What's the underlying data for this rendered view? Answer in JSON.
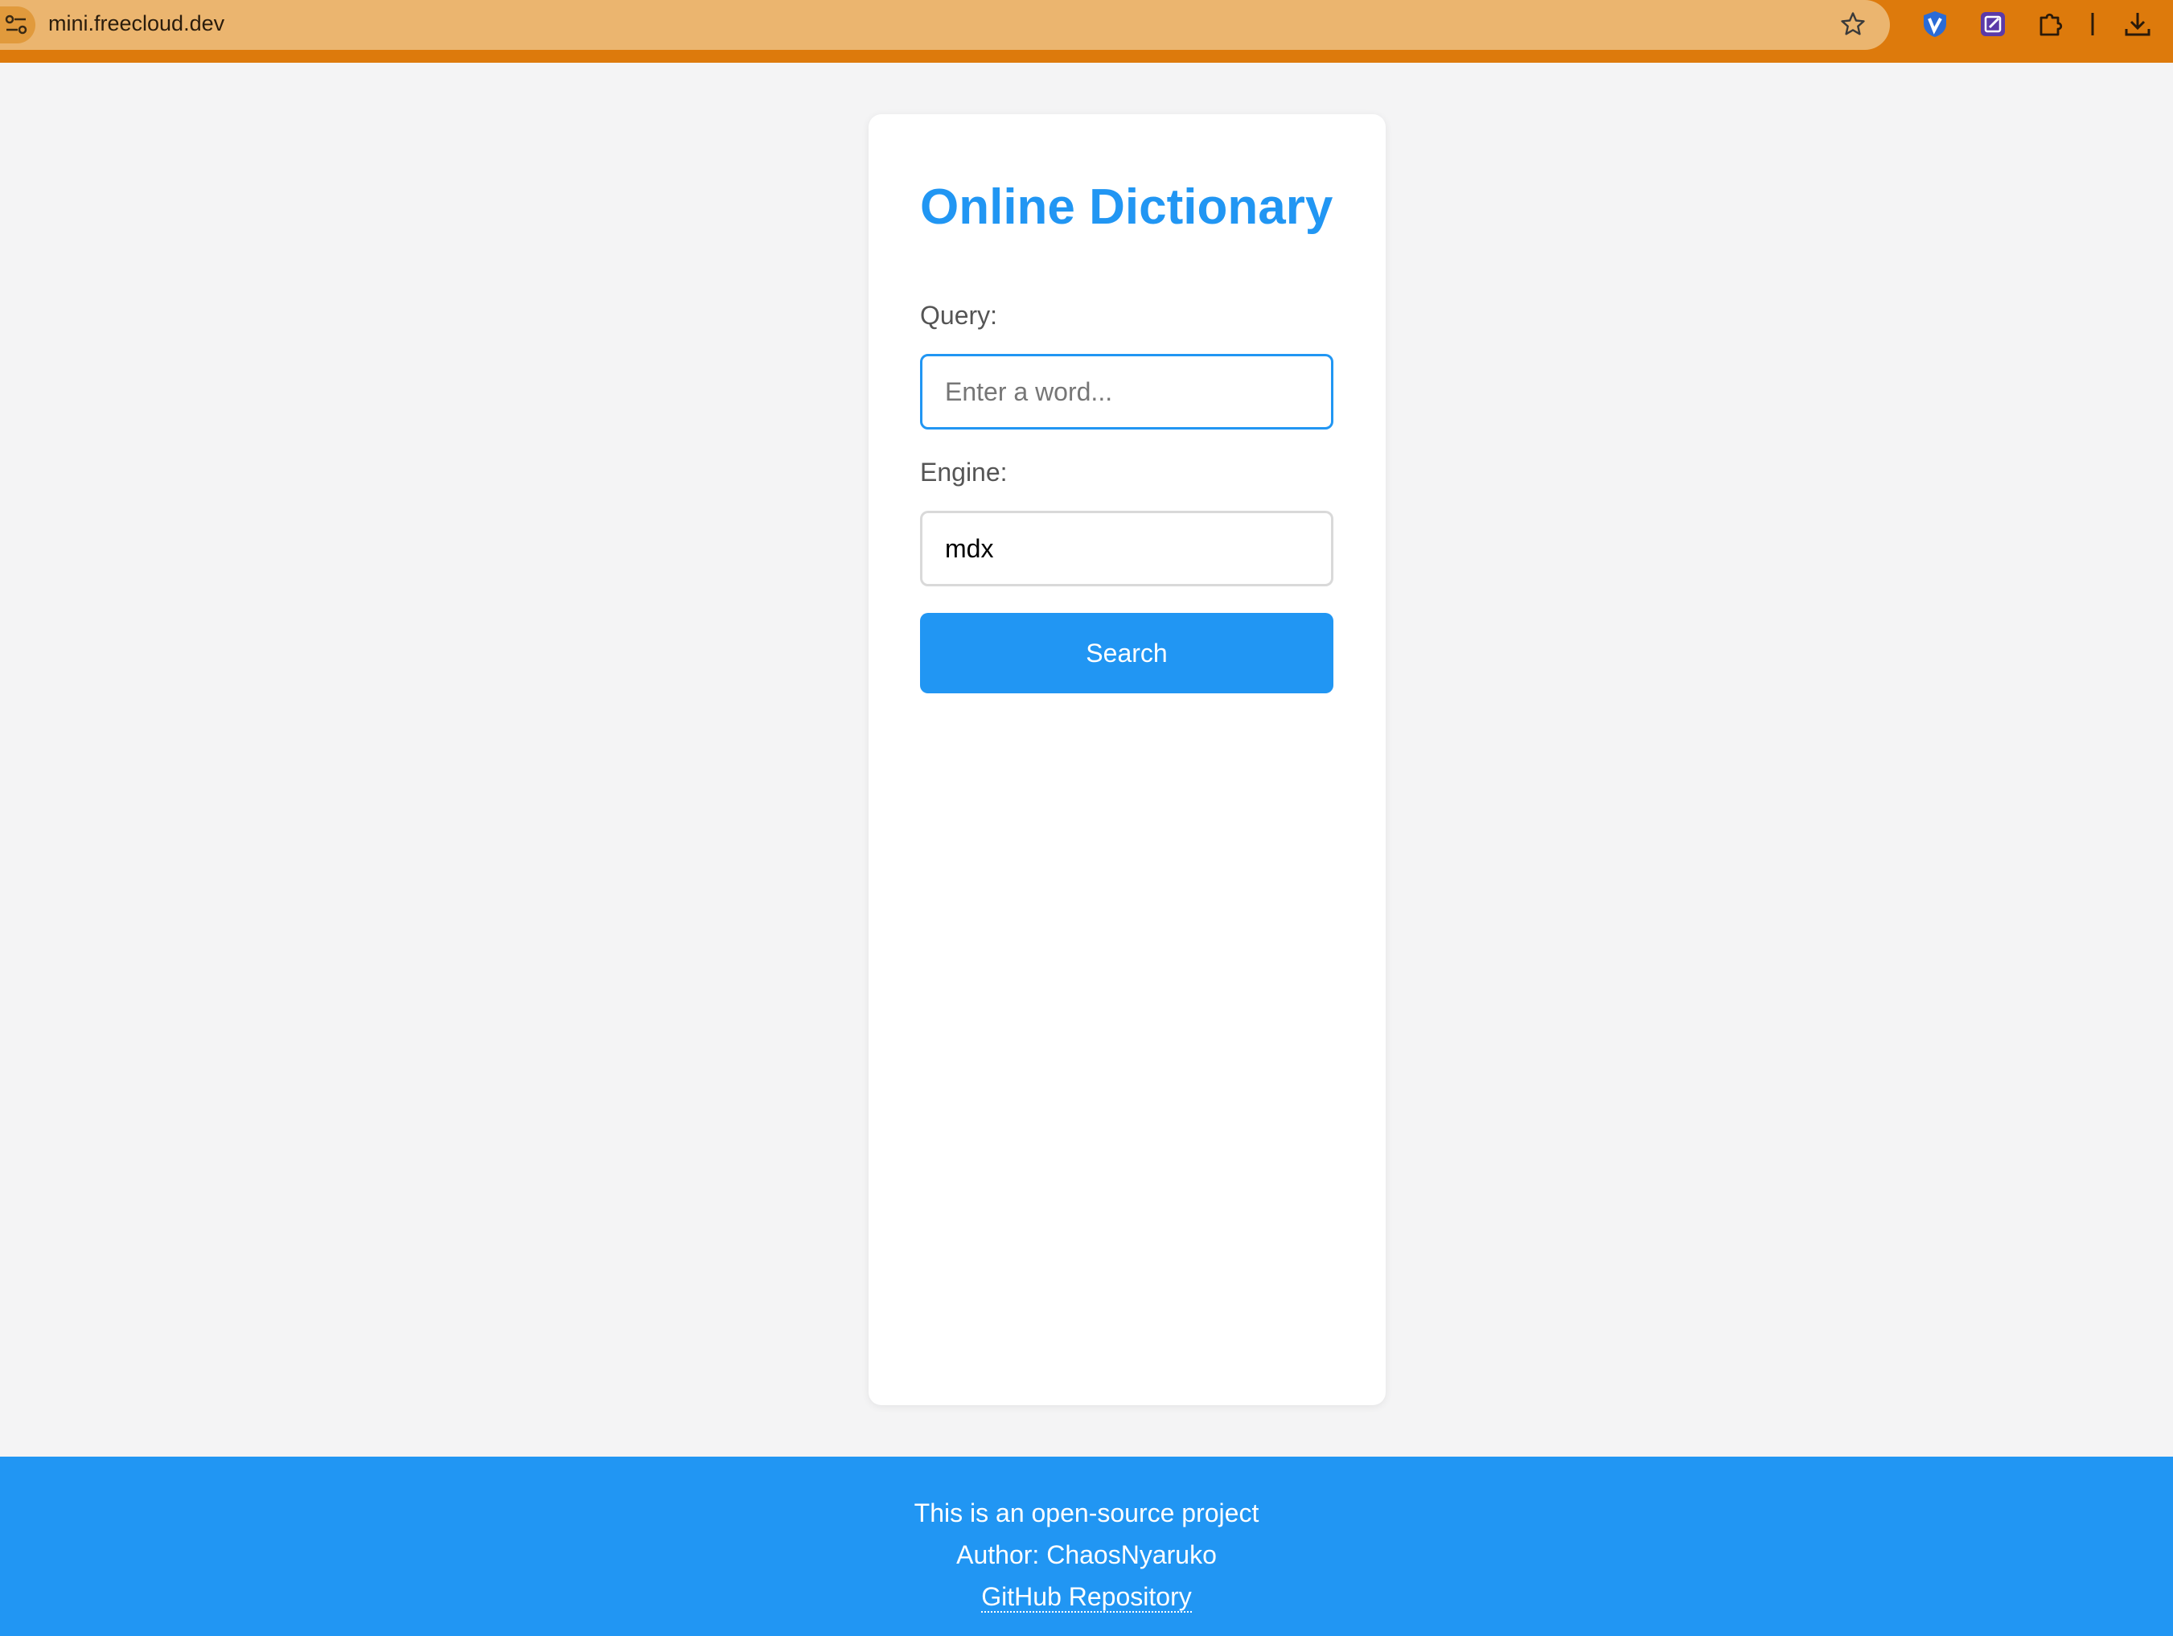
{
  "browser": {
    "url": "mini.freecloud.dev",
    "icons": [
      "site-settings-icon",
      "bookmark-star-icon",
      "vpn-extension-icon",
      "notes-extension-icon",
      "extensions-puzzle-icon",
      "download-icon"
    ]
  },
  "card": {
    "title": "Online Dictionary",
    "query": {
      "label": "Query:",
      "placeholder": "Enter a word...",
      "value": ""
    },
    "engine": {
      "label": "Engine:",
      "value": "mdx"
    },
    "search_button": "Search"
  },
  "footer": {
    "line1": "This is an open-source project",
    "line2": "Author: ChaosNyaruko",
    "link": "GitHub Repository"
  },
  "colors": {
    "accent": "#2196f3",
    "browser_bar": "#dd7a0c",
    "url_pill": "#ebb56f",
    "page_bg": "#f4f4f5"
  }
}
